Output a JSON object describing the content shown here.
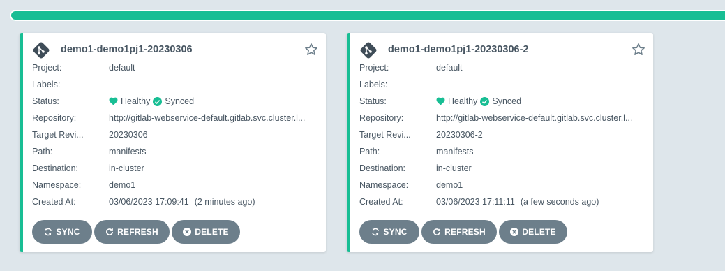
{
  "colors": {
    "accent": "#18be94",
    "button": "#6d7f8b",
    "text": "#495763",
    "background": "#dee6eb"
  },
  "progress": {
    "value": 1.0
  },
  "labels": {
    "project": "Project:",
    "labels": "Labels:",
    "status": "Status:",
    "repository": "Repository:",
    "target_revision": "Target Revi...",
    "path": "Path:",
    "destination": "Destination:",
    "namespace": "Namespace:",
    "created_at": "Created At:"
  },
  "buttons": {
    "sync": "SYNC",
    "refresh": "REFRESH",
    "delete": "DELETE"
  },
  "apps": [
    {
      "name": "demo1-demo1pj1-20230306",
      "project": "default",
      "labels": "",
      "health": "Healthy",
      "sync": "Synced",
      "repository": "http://gitlab-webservice-default.gitlab.svc.cluster.l...",
      "target_revision": "20230306",
      "path": "manifests",
      "destination": "in-cluster",
      "namespace": "demo1",
      "created_at": "03/06/2023 17:09:41",
      "created_ago": "(2 minutes ago)"
    },
    {
      "name": "demo1-demo1pj1-20230306-2",
      "project": "default",
      "labels": "",
      "health": "Healthy",
      "sync": "Synced",
      "repository": "http://gitlab-webservice-default.gitlab.svc.cluster.l...",
      "target_revision": "20230306-2",
      "path": "manifests",
      "destination": "in-cluster",
      "namespace": "demo1",
      "created_at": "03/06/2023 17:11:11",
      "created_ago": "(a few seconds ago)"
    }
  ]
}
